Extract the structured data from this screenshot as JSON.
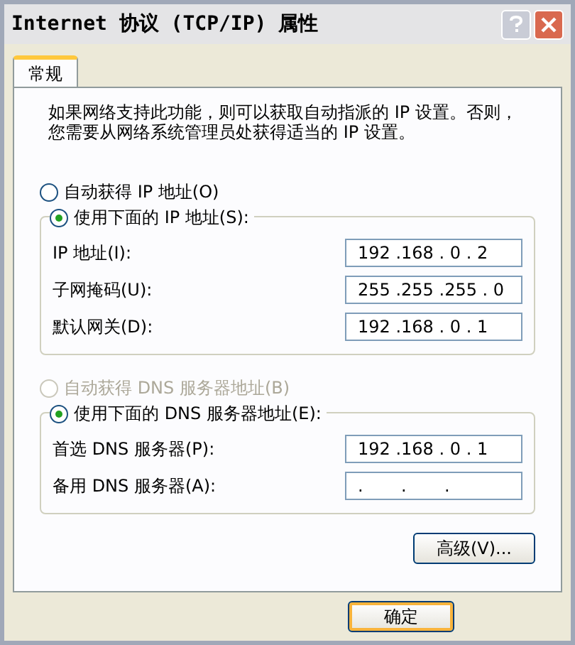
{
  "window": {
    "title": "Internet 协议 (TCP/IP) 属性"
  },
  "tabs": [
    {
      "label": "常规",
      "selected": true
    }
  ],
  "intro": "如果网络支持此功能，则可以获取自动指派的 IP 设置。否则，您需要从网络系统管理员处获得适当的 IP 设置。",
  "ip_mode": [
    {
      "label": "自动获得 IP 地址(O)",
      "selected": false,
      "disabled": false
    },
    {
      "label": "使用下面的 IP 地址(S):",
      "selected": true,
      "disabled": false
    }
  ],
  "ip_fields": [
    {
      "label": "IP 地址(I):",
      "value": "192 .168 . 0 . 2"
    },
    {
      "label": "子网掩码(U):",
      "value": "255 .255 .255 . 0"
    },
    {
      "label": "默认网关(D):",
      "value": "192 .168 . 0 . 1"
    }
  ],
  "dns_mode": [
    {
      "label": "自动获得 DNS 服务器地址(B)",
      "selected": false,
      "disabled": true
    },
    {
      "label": "使用下面的 DNS 服务器地址(E):",
      "selected": true,
      "disabled": false
    }
  ],
  "dns_fields": [
    {
      "label": "首选 DNS 服务器(P):",
      "value": "192 .168 . 0 . 1"
    },
    {
      "label": "备用 DNS 服务器(A):",
      "value": ".       .       ."
    }
  ],
  "buttons": {
    "advanced": "高级(V)...",
    "ok": "确定"
  }
}
